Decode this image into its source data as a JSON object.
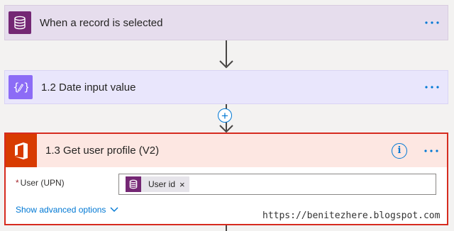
{
  "flow": {
    "steps": [
      {
        "title": "When a record is selected",
        "icon": "database-icon",
        "menu_icon": "more-options-icon"
      },
      {
        "title": "1.2 Date input value",
        "icon": "compose-icon",
        "menu_icon": "more-options-icon"
      },
      {
        "title": "1.3 Get user profile (V2)",
        "icon": "office-icon",
        "info_icon": "info-icon",
        "menu_icon": "more-options-icon",
        "field": {
          "required_mark": "*",
          "label": "User (UPN)",
          "token": {
            "label": "User id",
            "icon": "database-icon",
            "remove": "×"
          }
        },
        "advanced_link": "Show advanced options"
      }
    ],
    "insert_step_icon": "+"
  },
  "watermark": "https://benitezhere.blogspot.com",
  "colors": {
    "trigger_header": "#e6dded",
    "trigger_icon": "#742774",
    "compose_header": "#e9e6fc",
    "compose_icon": "#8c6cf6",
    "office_header": "#fde7e2",
    "office_icon": "#d83b01",
    "selected_border": "#d62b1f",
    "accent": "#0078d4"
  }
}
